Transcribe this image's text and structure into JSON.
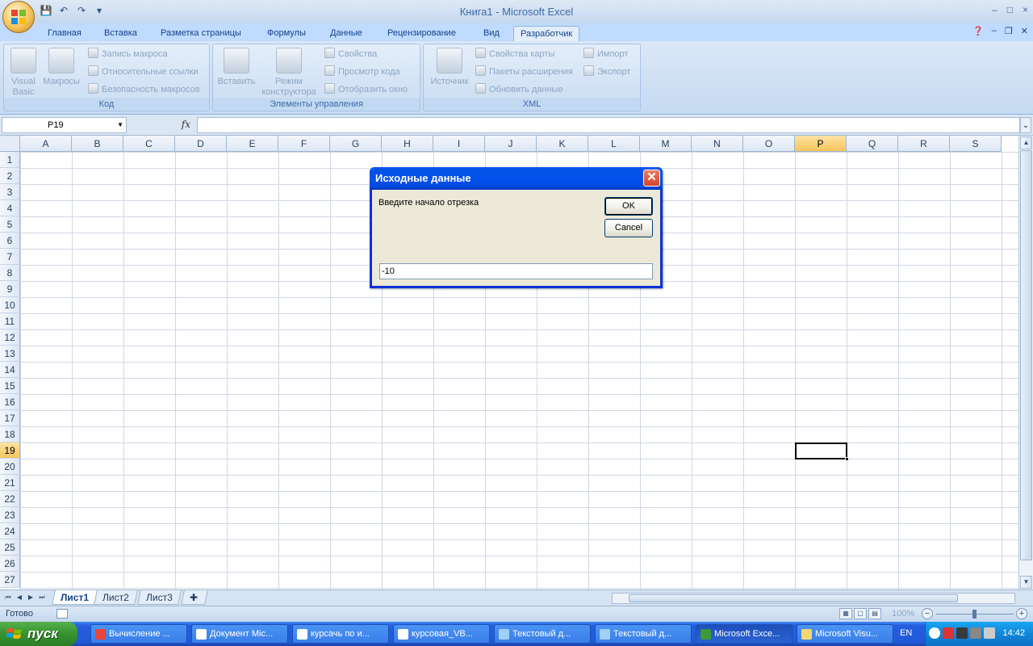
{
  "window": {
    "title": "Книга1 - Microsoft Excel",
    "controls": [
      "–",
      "□",
      "×"
    ]
  },
  "ribbon": {
    "tabs": [
      "Главная",
      "Вставка",
      "Разметка страницы",
      "Формулы",
      "Данные",
      "Рецензирование",
      "Вид",
      "Разработчик"
    ],
    "active_tab": "Разработчик",
    "groups": {
      "code": {
        "label": "Код",
        "visual_basic": "Visual Basic",
        "macros": "Макросы",
        "record_macro": "Запись макроса",
        "relative_refs": "Относительные ссылки",
        "macro_security": "Безопасность макросов"
      },
      "controls": {
        "label": "Элементы управления",
        "insert": "Вставить",
        "design_mode": "Режим конструктора",
        "properties": "Свойства",
        "view_code": "Просмотр кода",
        "run_dialog": "Отобразить окно"
      },
      "xml": {
        "label": "XML",
        "source": "Источник",
        "map_properties": "Свойства карты",
        "expansion_packs": "Пакеты расширения",
        "refresh_data": "Обновить данные",
        "import": "Импорт",
        "export": "Экспорт"
      }
    }
  },
  "formula_bar": {
    "name_box": "P19",
    "fx": "fx",
    "formula": ""
  },
  "grid": {
    "columns": [
      "A",
      "B",
      "C",
      "D",
      "E",
      "F",
      "G",
      "H",
      "I",
      "J",
      "K",
      "L",
      "M",
      "N",
      "O",
      "P",
      "Q",
      "R",
      "S"
    ],
    "rows": [
      "1",
      "2",
      "3",
      "4",
      "5",
      "6",
      "7",
      "8",
      "9",
      "10",
      "11",
      "12",
      "13",
      "14",
      "15",
      "16",
      "17",
      "18",
      "19",
      "20",
      "21",
      "22",
      "23",
      "24",
      "25",
      "26",
      "27"
    ],
    "selected_column": "P",
    "selected_row": "19"
  },
  "sheets": {
    "tabs": [
      "Лист1",
      "Лист2",
      "Лист3"
    ],
    "active": "Лист1"
  },
  "status": {
    "text": "Готово",
    "zoom": "100%"
  },
  "dialog": {
    "title": "Исходные данные",
    "prompt": "Введите начало отрезка",
    "ok": "OK",
    "cancel": "Cancel",
    "input_value": "-10"
  },
  "taskbar": {
    "start": "пуск",
    "items": [
      "Вычисление ...",
      "Документ Mic...",
      "курсачь по и...",
      "курсовая_VB...",
      "Текстовый д...",
      "Текстовый д...",
      "Microsoft Exce...",
      "Microsoft Visu..."
    ],
    "active_item": "Microsoft Exce...",
    "language": "EN",
    "clock": "14:42"
  }
}
